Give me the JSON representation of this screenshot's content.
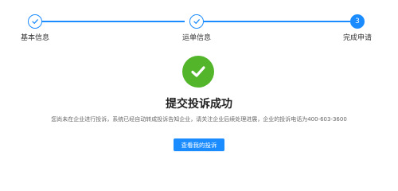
{
  "steps": [
    {
      "label": "基本信息",
      "status": "done"
    },
    {
      "label": "运单信息",
      "status": "done"
    },
    {
      "label": "完成申请",
      "status": "current",
      "number": "3"
    }
  ],
  "result": {
    "icon": "check-circle-icon",
    "title": "提交投诉成功",
    "description": "您尚未在企业进行投诉，系统已经自动转成投诉告知企业，请关注企业后续处理进展，企业的投诉电话为400-603-3600",
    "button_label": "查看我的投诉"
  },
  "colors": {
    "accent": "#1a8cff",
    "success": "#52b52a"
  }
}
